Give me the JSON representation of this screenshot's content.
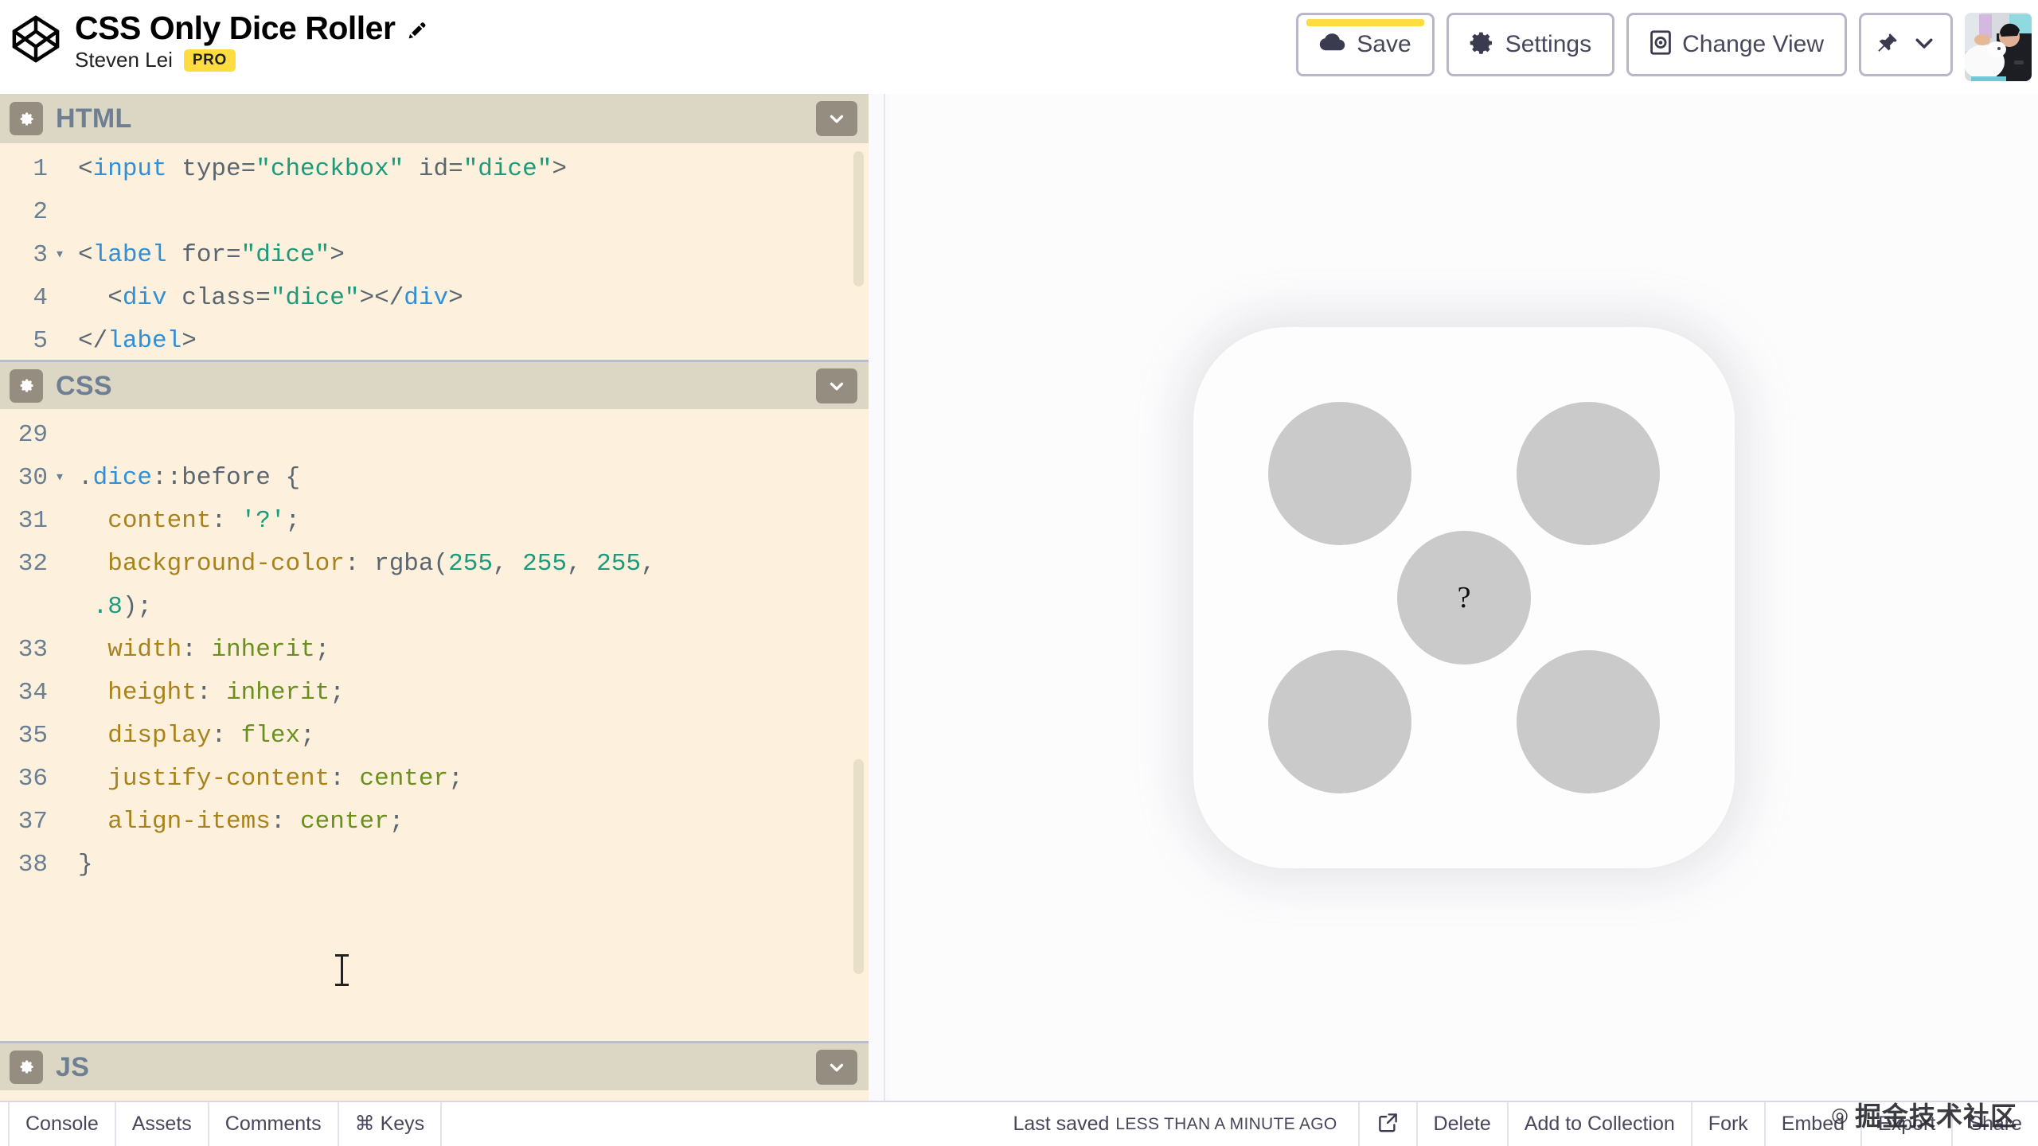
{
  "header": {
    "pen_title": "CSS Only Dice Roller",
    "author": "Steven Lei",
    "pro_badge": "PRO",
    "edit_icon": "pencil-icon",
    "logo_icon": "codepen-logo-icon",
    "toolbar": [
      {
        "label": "Save",
        "icon": "cloud-icon",
        "unsaved": true
      },
      {
        "label": "Settings",
        "icon": "gear-icon"
      },
      {
        "label": "Change View",
        "icon": "change-view-icon"
      }
    ],
    "pin_button": {
      "icon": "pin-icon",
      "chevron": "chevron-down-icon"
    },
    "avatar": "user-avatar"
  },
  "editors": {
    "html": {
      "label": "HTML",
      "gear_icon": "gear-icon",
      "collapse_icon": "chevron-down-icon",
      "lines": [
        {
          "num": "1",
          "fold": "",
          "tokens": [
            {
              "t": "<",
              "c": "t-punc"
            },
            {
              "t": "input",
              "c": "t-tag"
            },
            {
              "t": " type=",
              "c": "t-attr"
            },
            {
              "t": "\"checkbox\"",
              "c": "t-str"
            },
            {
              "t": " id=",
              "c": "t-attr"
            },
            {
              "t": "\"dice\"",
              "c": "t-str"
            },
            {
              "t": ">",
              "c": "t-punc"
            }
          ]
        },
        {
          "num": "2",
          "fold": "",
          "tokens": []
        },
        {
          "num": "3",
          "fold": "▾",
          "tokens": [
            {
              "t": "<",
              "c": "t-punc"
            },
            {
              "t": "label",
              "c": "t-tag"
            },
            {
              "t": " for=",
              "c": "t-attr"
            },
            {
              "t": "\"dice\"",
              "c": "t-str"
            },
            {
              "t": ">",
              "c": "t-punc"
            }
          ]
        },
        {
          "num": "4",
          "fold": "",
          "tokens": [
            {
              "t": "  <",
              "c": "t-punc"
            },
            {
              "t": "div",
              "c": "t-tag"
            },
            {
              "t": " class=",
              "c": "t-attr"
            },
            {
              "t": "\"dice\"",
              "c": "t-str"
            },
            {
              "t": "></",
              "c": "t-punc"
            },
            {
              "t": "div",
              "c": "t-tag"
            },
            {
              "t": ">",
              "c": "t-punc"
            }
          ]
        },
        {
          "num": "5",
          "fold": "",
          "tokens": [
            {
              "t": "</",
              "c": "t-punc"
            },
            {
              "t": "label",
              "c": "t-tag"
            },
            {
              "t": ">",
              "c": "t-punc"
            }
          ]
        }
      ]
    },
    "css": {
      "label": "CSS",
      "gear_icon": "gear-icon",
      "collapse_icon": "chevron-down-icon",
      "lines": [
        {
          "num": "29",
          "fold": "",
          "tokens": []
        },
        {
          "num": "30",
          "fold": "▾",
          "tokens": [
            {
              "t": ".",
              "c": "t-punc"
            },
            {
              "t": "dice",
              "c": "t-sel"
            },
            {
              "t": "::before {",
              "c": "t-punc"
            }
          ]
        },
        {
          "num": "31",
          "fold": "",
          "tokens": [
            {
              "t": "  ",
              "c": "t-punc"
            },
            {
              "t": "content",
              "c": "t-prop"
            },
            {
              "t": ": ",
              "c": "t-punc"
            },
            {
              "t": "'?'",
              "c": "t-num"
            },
            {
              "t": ";",
              "c": "t-punc"
            }
          ]
        },
        {
          "num": "32",
          "fold": "",
          "tokens": [
            {
              "t": "  ",
              "c": "t-punc"
            },
            {
              "t": "background-color",
              "c": "t-prop"
            },
            {
              "t": ": ",
              "c": "t-punc"
            },
            {
              "t": "rgba(",
              "c": "t-fn"
            },
            {
              "t": "255",
              "c": "t-num"
            },
            {
              "t": ", ",
              "c": "t-punc"
            },
            {
              "t": "255",
              "c": "t-num"
            },
            {
              "t": ", ",
              "c": "t-punc"
            },
            {
              "t": "255",
              "c": "t-num"
            },
            {
              "t": ",",
              "c": "t-punc"
            }
          ]
        },
        {
          "num": "",
          "fold": "",
          "wrapped": true,
          "tokens": [
            {
              "t": " ",
              "c": "t-punc"
            },
            {
              "t": ".8",
              "c": "t-num"
            },
            {
              "t": ");",
              "c": "t-punc"
            }
          ]
        },
        {
          "num": "33",
          "fold": "",
          "tokens": [
            {
              "t": "  ",
              "c": "t-punc"
            },
            {
              "t": "width",
              "c": "t-prop"
            },
            {
              "t": ": ",
              "c": "t-punc"
            },
            {
              "t": "inherit",
              "c": "t-val"
            },
            {
              "t": ";",
              "c": "t-punc"
            }
          ]
        },
        {
          "num": "34",
          "fold": "",
          "tokens": [
            {
              "t": "  ",
              "c": "t-punc"
            },
            {
              "t": "height",
              "c": "t-prop"
            },
            {
              "t": ": ",
              "c": "t-punc"
            },
            {
              "t": "inherit",
              "c": "t-val"
            },
            {
              "t": ";",
              "c": "t-punc"
            }
          ]
        },
        {
          "num": "35",
          "fold": "",
          "tokens": [
            {
              "t": "  ",
              "c": "t-punc"
            },
            {
              "t": "display",
              "c": "t-prop"
            },
            {
              "t": ": ",
              "c": "t-punc"
            },
            {
              "t": "flex",
              "c": "t-val"
            },
            {
              "t": ";",
              "c": "t-punc"
            }
          ]
        },
        {
          "num": "36",
          "fold": "",
          "tokens": [
            {
              "t": "  ",
              "c": "t-punc"
            },
            {
              "t": "justify-content",
              "c": "t-prop"
            },
            {
              "t": ": ",
              "c": "t-punc"
            },
            {
              "t": "center",
              "c": "t-val"
            },
            {
              "t": ";",
              "c": "t-punc"
            }
          ]
        },
        {
          "num": "37",
          "fold": "",
          "tokens": [
            {
              "t": "  ",
              "c": "t-punc"
            },
            {
              "t": "align-items",
              "c": "t-prop"
            },
            {
              "t": ": ",
              "c": "t-punc"
            },
            {
              "t": "center",
              "c": "t-val"
            },
            {
              "t": ";",
              "c": "t-punc"
            }
          ]
        },
        {
          "num": "38",
          "fold": "",
          "tokens": [
            {
              "t": "}",
              "c": "t-punc"
            }
          ]
        }
      ]
    },
    "js": {
      "label": "JS",
      "gear_icon": "gear-icon",
      "collapse_icon": "chevron-down-icon"
    }
  },
  "preview": {
    "dice_center_label": "?",
    "pip_color": "#cacaca",
    "dice_color": "#fdfdfd",
    "pip_count": 5
  },
  "bottombar": {
    "left_tabs": [
      "Console",
      "Assets",
      "Comments",
      "⌘ Keys"
    ],
    "saved_prefix": "Last saved",
    "saved_value": "LESS THAN A MINUTE AGO",
    "external_icon": "external-link-icon",
    "right_items": [
      "Delete",
      "Add to Collection",
      "Fork",
      "Embed",
      "Export",
      "Share"
    ]
  },
  "watermark": {
    "mark": "◎",
    "text": "掘金技术社区"
  }
}
